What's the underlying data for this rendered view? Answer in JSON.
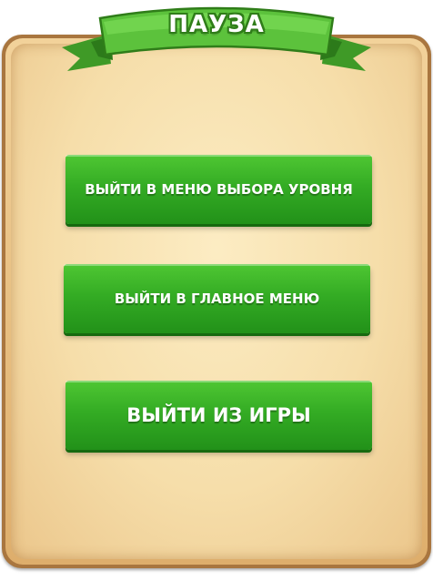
{
  "dialog": {
    "title": "ПАУЗА",
    "buttons": [
      {
        "label": "ВЫЙТИ В МЕНЮ ВЫБОРА УРОВНЯ"
      },
      {
        "label": "ВЫЙТИ В ГЛАВНОЕ МЕНЮ"
      },
      {
        "label": "ВЫЙТИ ИЗ ИГРЫ"
      }
    ]
  },
  "colors": {
    "panel_border": "#a9763f",
    "panel_fill": "#f6deaa",
    "ribbon": "#6bd44a",
    "button": "#34ac24",
    "button_text": "#ffffff"
  }
}
